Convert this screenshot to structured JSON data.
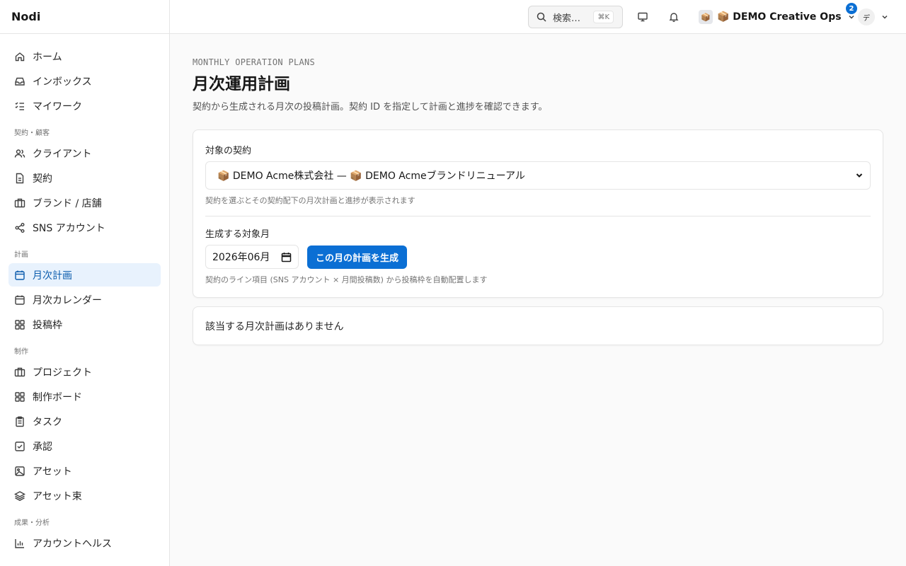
{
  "app": {
    "name": "Nodi"
  },
  "sidebar": {
    "groups": [
      {
        "section": "",
        "items": [
          {
            "label": "ホーム",
            "icon": "home-icon"
          },
          {
            "label": "インボックス",
            "icon": "inbox-icon"
          },
          {
            "label": "マイワーク",
            "icon": "list-check-icon"
          }
        ]
      },
      {
        "section": "契約・顧客",
        "items": [
          {
            "label": "クライアント",
            "icon": "users-icon"
          },
          {
            "label": "契約",
            "icon": "document-icon"
          },
          {
            "label": "ブランド / 店舗",
            "icon": "briefcase-icon"
          },
          {
            "label": "SNS アカウント",
            "icon": "share-icon"
          }
        ]
      },
      {
        "section": "計画",
        "items": [
          {
            "label": "月次計画",
            "icon": "calendar-icon",
            "active": true
          },
          {
            "label": "月次カレンダー",
            "icon": "calendar-icon"
          },
          {
            "label": "投稿枠",
            "icon": "grid-icon"
          }
        ]
      },
      {
        "section": "制作",
        "items": [
          {
            "label": "プロジェクト",
            "icon": "briefcase-icon"
          },
          {
            "label": "制作ボード",
            "icon": "grid-icon"
          },
          {
            "label": "タスク",
            "icon": "clipboard-icon"
          },
          {
            "label": "承認",
            "icon": "check-square-icon"
          },
          {
            "label": "アセット",
            "icon": "image-icon"
          },
          {
            "label": "アセット束",
            "icon": "layers-icon"
          }
        ]
      },
      {
        "section": "成果・分析",
        "items": [
          {
            "label": "アカウントヘルス",
            "icon": "bar-chart-icon"
          }
        ]
      }
    ]
  },
  "header": {
    "search": {
      "label": "検索…",
      "shortcut": "⌘K"
    },
    "notifications": {
      "count": "2"
    },
    "workspace": {
      "avatar": "📦",
      "name": "📦 DEMO Creative Ops"
    },
    "user": {
      "initial": "デ"
    }
  },
  "page": {
    "eyebrow": "MONTHLY OPERATION PLANS",
    "title": "月次運用計画",
    "description": "契約から生成される月次の投稿計画。契約 ID を指定して計画と進捗を確認できます。"
  },
  "form": {
    "contract_label": "対象の契約",
    "contract_value": "📦 DEMO Acme株式会社 — 📦 DEMO Acmeブランドリニューアル",
    "contract_hint": "契約を選ぶとその契約配下の月次計画と進捗が表示されます",
    "month_label": "生成する対象月",
    "month_value": "2026年06月",
    "generate_button": "この月の計画を生成",
    "month_hint": "契約のライン項目 (SNS アカウント × 月間投稿数) から投稿枠を自動配置します"
  },
  "empty_state": {
    "message": "該当する月次計画はありません"
  },
  "colors": {
    "accent": "#0b6fd4",
    "active_bg": "#e8f2fd"
  }
}
